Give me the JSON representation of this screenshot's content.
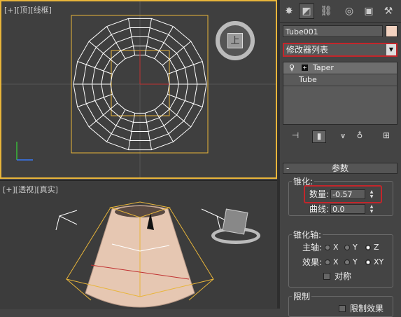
{
  "viewport_top": {
    "label": "[+][顶][线框]"
  },
  "viewport_persp": {
    "label": "[+][透视][真实]"
  },
  "viewcube_top": {
    "face": "上"
  },
  "command_panel": {
    "tabs": [
      {
        "name": "create-tab",
        "glyph": "✸"
      },
      {
        "name": "modify-tab",
        "glyph": "◩"
      },
      {
        "name": "hierarchy-tab",
        "glyph": "⛓"
      },
      {
        "name": "motion-tab",
        "glyph": "◎"
      },
      {
        "name": "display-tab",
        "glyph": "▣"
      },
      {
        "name": "utilities-tab",
        "glyph": "⚒"
      }
    ],
    "object_name": "Tube001",
    "object_color": "#f2d2c0",
    "modifier_list": "修改器列表",
    "stack": [
      {
        "label": "Taper",
        "selected": true
      },
      {
        "label": "Tube",
        "selected": false
      }
    ]
  },
  "params": {
    "title": "参数",
    "minus": "-",
    "taper_group": "锥化:",
    "amount_label": "数量:",
    "amount_value": "-0.57",
    "curve_label": "曲线:",
    "curve_value": "0.0",
    "axis_group": "锥化轴:",
    "primary_label": "主轴:",
    "effect_label": "效果:",
    "x": "X",
    "y": "Y",
    "z": "Z",
    "xy": "XY",
    "symmetry_label": "对称",
    "limit_group": "限制",
    "limit_effect_label": "限制效果"
  },
  "colors": {
    "highlight": "#c3262b",
    "selection": "#e8b53a",
    "object": "#f2d2c0"
  }
}
